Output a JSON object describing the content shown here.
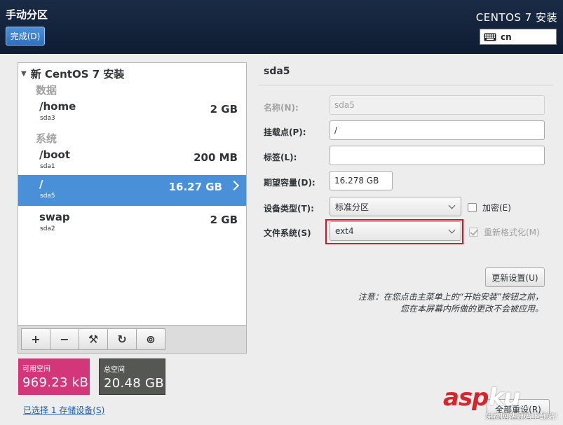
{
  "header": {
    "title": "手动分区",
    "done_label": "完成(D)",
    "product": "CENTOS 7 安装",
    "keyboard_layout": "cn"
  },
  "tree": {
    "root_label": "新 CentOS 7 安装",
    "groups": [
      {
        "label": "数据"
      },
      {
        "label": "系统"
      }
    ],
    "partitions": [
      {
        "mount": "/home",
        "device": "sda3",
        "size": "2 GB"
      },
      {
        "mount": "/boot",
        "device": "sda1",
        "size": "200 MB"
      },
      {
        "mount": "/",
        "device": "sda5",
        "size": "16.27 GB"
      },
      {
        "mount": "swap",
        "device": "sda2",
        "size": "2 GB"
      }
    ]
  },
  "toolbar": {
    "add": "+",
    "remove": "−",
    "configure": "⚒",
    "refresh": "↻",
    "disk": "⊚"
  },
  "space": {
    "available_label": "可用空间",
    "available_value": "969.23 kB",
    "total_label": "总空间",
    "total_value": "20.48 GB"
  },
  "storage_link": "已选择 1 存储设备(S)",
  "detail": {
    "title": "sda5",
    "name_label": "名称(N):",
    "name_value": "sda5",
    "mount_label": "挂载点(P):",
    "mount_value": "/",
    "tag_label": "标签(L):",
    "tag_value": "",
    "capacity_label": "期望容量(D):",
    "capacity_value": "16.278 GB",
    "devtype_label": "设备类型(T):",
    "devtype_value": "标准分区",
    "encrypt_label": "加密(E)",
    "fs_label": "文件系统(S)",
    "fs_value": "ext4",
    "reformat_label": "重新格式化(M)",
    "update_label": "更新设置(U)",
    "note_line1": "注意：在您点击主菜单上的“开始安装”按钮之前，",
    "note_line2": "您在本屏幕内所做的更改不会被应用。",
    "reset_label": "全部重设(R)"
  },
  "watermark": {
    "main_a": "asp",
    "main_b": "ku",
    "sub": "免费网站源码下载站!"
  }
}
